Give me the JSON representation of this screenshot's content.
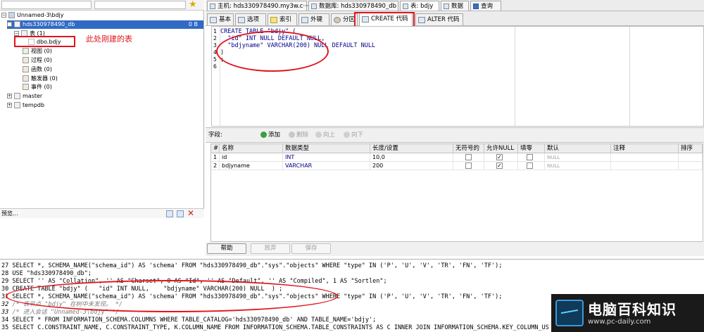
{
  "left_panel": {
    "tree": {
      "connection": "Unnamed-3\\bdjy",
      "database": "hds330978490_db",
      "database_size": "0 B",
      "tables_folder": "表 (1)",
      "table": "dbo.bdjy",
      "views": "视图 (0)",
      "procedures": "过程 (0)",
      "functions": "函数 (0)",
      "triggers": "触发器 (0)",
      "events": "事件 (0)",
      "master": "master",
      "tempdb": "tempdb"
    },
    "preview_label": "预览..."
  },
  "annotation_note": "此处刚建的表",
  "top_tabs": [
    {
      "label": "主机: hds330978490.my3w.c···"
    },
    {
      "label": "数据库: hds330978490_db"
    },
    {
      "label": "表: bdjy"
    },
    {
      "label": "数据"
    },
    {
      "label": "查询"
    }
  ],
  "sub_tabs": [
    {
      "label": "基本"
    },
    {
      "label": "选项"
    },
    {
      "label": "索引"
    },
    {
      "label": "外键"
    },
    {
      "label": "分区"
    },
    {
      "label": "CREATE 代码"
    },
    {
      "label": "ALTER 代码"
    }
  ],
  "editor": {
    "line_numbers": [
      "1",
      "2",
      "3",
      "4",
      "5",
      "6"
    ],
    "lines": [
      "CREATE TABLE \"bdjy\" (",
      "  \"id\" INT NULL DEFAULT NULL,",
      "  \"bdjyname\" VARCHAR(200) NULL DEFAULT NULL",
      ")",
      ";",
      ""
    ]
  },
  "fields_toolbar": {
    "label": "字段:",
    "add": "添加",
    "delete": "删除",
    "up": "向上",
    "down": "向下"
  },
  "grid": {
    "headers": [
      "#",
      "名称",
      "数据类型",
      "长度/设置",
      "无符号的",
      "允许NULL",
      "填零",
      "默认",
      "注释",
      "排序"
    ],
    "rows": [
      {
        "num": "1",
        "name": "id",
        "type": "INT",
        "length": "10,0",
        "unsigned": false,
        "allow_null": true,
        "zerofill": false,
        "default": "NULL"
      },
      {
        "num": "2",
        "name": "bdjyname",
        "type": "VARCHAR",
        "length": "200",
        "unsigned": false,
        "allow_null": true,
        "zerofill": false,
        "default": "NULL"
      }
    ]
  },
  "buttons": {
    "help": "帮助",
    "discard": "放弃",
    "save": "保存"
  },
  "log": [
    {
      "num": "27",
      "text": "SELECT *, SCHEMA_NAME(\"schema_id\") AS 'schema' FROM \"hds330978490_db\".\"sys\".\"objects\" WHERE \"type\" IN ('P', 'U', 'V', 'TR', 'FN', 'TF');",
      "comment": false
    },
    {
      "num": "28",
      "text": "USE \"hds330978490_db\";",
      "comment": false
    },
    {
      "num": "29",
      "text": "SELECT '' AS \"Collation\", '' AS \"Charset\", 0 AS \"Id\", '' AS \"Default\", '' AS \"Compiled\", 1 AS \"Sortlen\";",
      "comment": false
    },
    {
      "num": "30",
      "text": "CREATE TABLE \"bdjy\" (   \"id\" INT NULL,    \"bdjyname\" VARCHAR(200) NULL  ) ;",
      "comment": false
    },
    {
      "num": "31",
      "text": "SELECT *, SCHEMA_NAME(\"schema_id\") AS 'schema' FROM \"hds330978490_db\".\"sys\".\"objects\" WHERE \"type\" IN ('P', 'U', 'V', 'TR', 'FN', 'TF');",
      "comment": false
    },
    {
      "num": "32",
      "text": "/* 表节点 \"bdjy\" 在树中未发现。 */",
      "comment": true
    },
    {
      "num": "33",
      "text": "/* 进入会话 \"Unnamed-3\\bdjy\" */",
      "comment": true
    },
    {
      "num": "34",
      "text": "SELECT * FROM INFORMATION_SCHEMA.COLUMNS WHERE TABLE_CATALOG='hds330978490_db' AND TABLE_NAME='bdjy';",
      "comment": false
    },
    {
      "num": "35",
      "text": "SELECT C.CONSTRAINT_NAME, C.CONSTRAINT_TYPE, K.COLUMN_NAME FROM INFORMATION_SCHEMA.TABLE_CONSTRAINTS AS C INNER JOIN INFORMATION_SCHEMA.KEY_COLUMN_US",
      "comment": false
    }
  ],
  "watermark": {
    "title": "电脑百科知识",
    "url": "www.pc-daily.com"
  },
  "colors": {
    "annotation_red": "#e0141c",
    "selection_blue": "#316ac5",
    "sql_keyword": "#00008b"
  }
}
